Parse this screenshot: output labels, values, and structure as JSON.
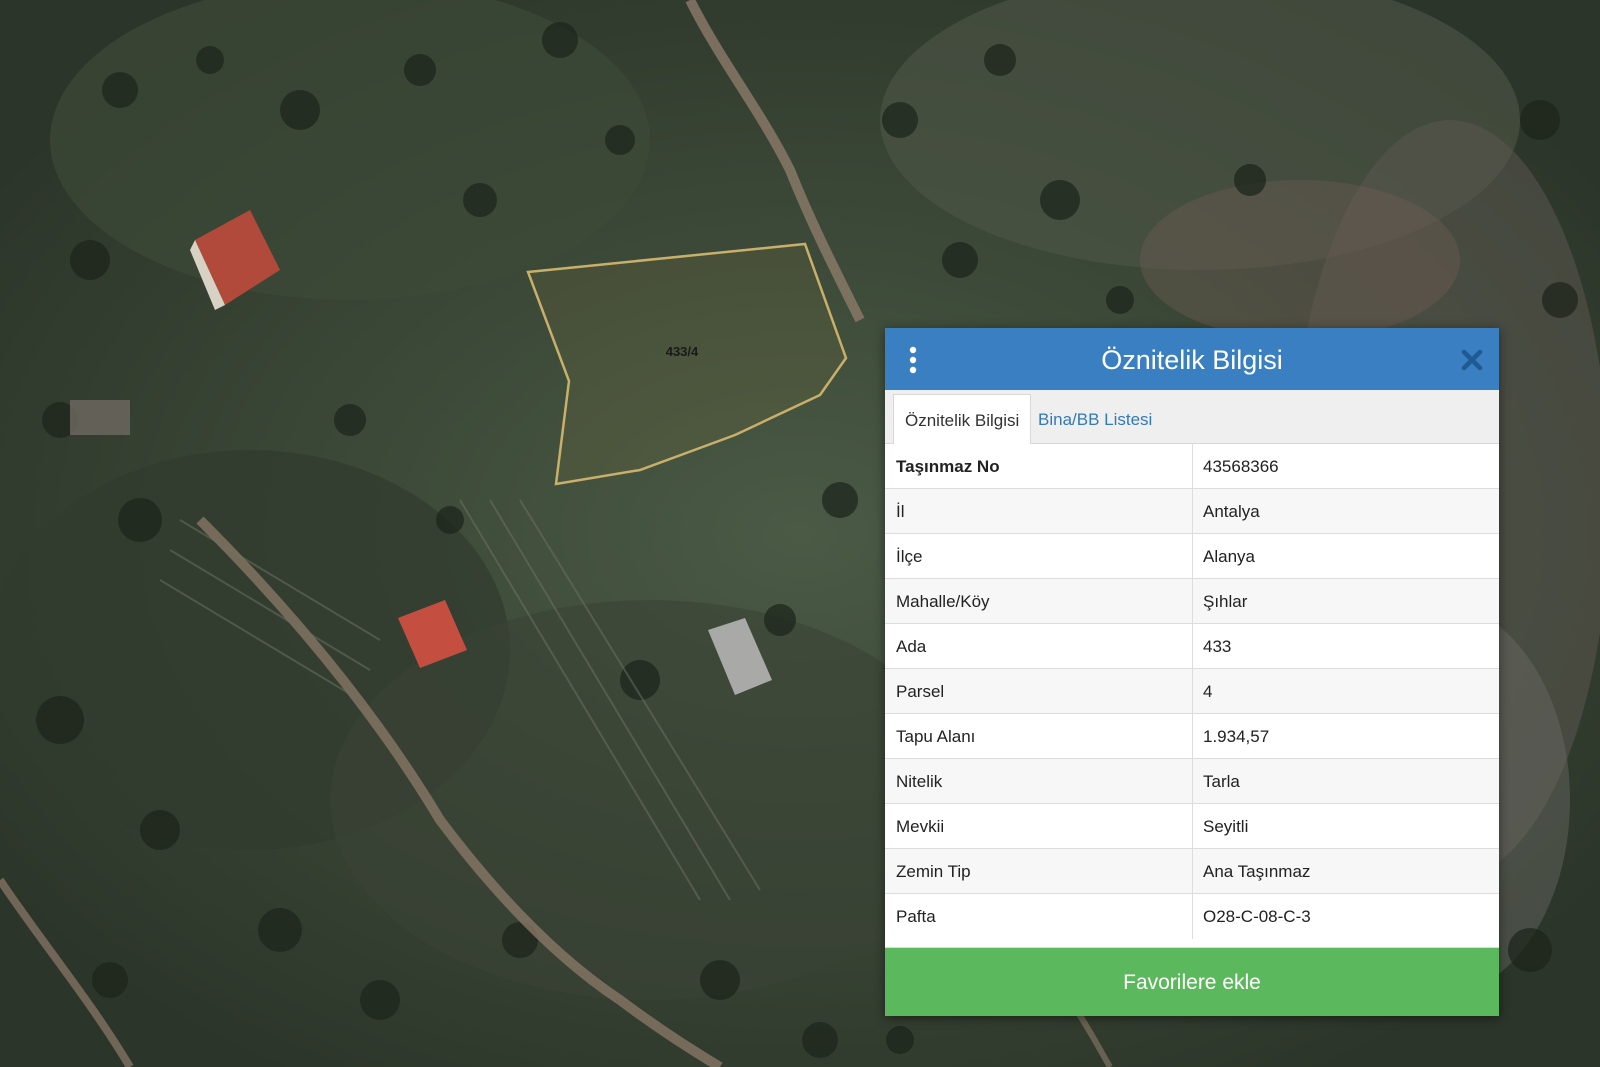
{
  "map": {
    "parcel_label": "433/4",
    "parcel_outline_color": "#c9b06a"
  },
  "panel": {
    "title": "Öznitelik Bilgisi",
    "menu_icon": "vertical-dots-icon",
    "close_icon": "close-icon",
    "header_color": "#3a7fc1",
    "tabs": [
      {
        "label": "Öznitelik Bilgisi",
        "active": true
      },
      {
        "label": "Bina/BB Listesi",
        "active": false
      }
    ],
    "rows": [
      {
        "key": "Taşınmaz No",
        "value": "43568366"
      },
      {
        "key": "İl",
        "value": "Antalya"
      },
      {
        "key": "İlçe",
        "value": "Alanya"
      },
      {
        "key": "Mahalle/Köy",
        "value": "Şıhlar"
      },
      {
        "key": "Ada",
        "value": "433"
      },
      {
        "key": "Parsel",
        "value": "4"
      },
      {
        "key": "Tapu Alanı",
        "value": "1.934,57"
      },
      {
        "key": "Nitelik",
        "value": "Tarla"
      },
      {
        "key": "Mevkii",
        "value": "Seyitli"
      },
      {
        "key": "Zemin Tip",
        "value": "Ana Taşınmaz"
      },
      {
        "key": "Pafta",
        "value": "O28-C-08-C-3"
      }
    ],
    "favorite_button_label": "Favorilere ekle",
    "favorite_button_color": "#5cb85c"
  }
}
